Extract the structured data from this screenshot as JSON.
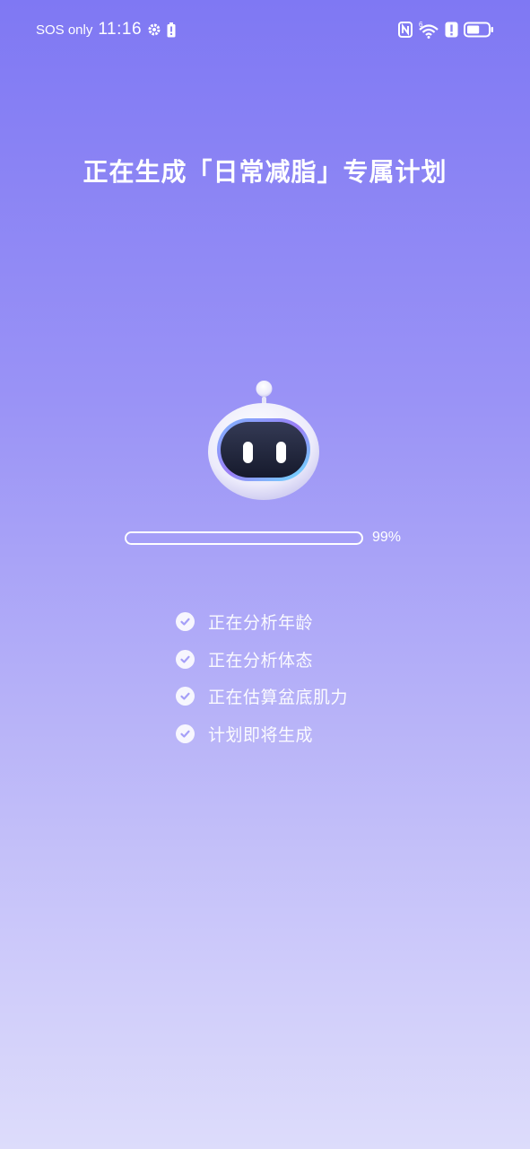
{
  "status_bar": {
    "carrier": "SOS only",
    "time": "11:16",
    "battery_level": 0.6,
    "icons": [
      "settings-icon",
      "battery-alert-icon",
      "nfc-icon",
      "wifi-icon",
      "alert-icon",
      "battery-icon"
    ]
  },
  "page": {
    "title": "正在生成「日常减脂」专属计划"
  },
  "progress": {
    "value": 99,
    "label": "99%"
  },
  "steps": [
    {
      "label": "正在分析年龄"
    },
    {
      "label": "正在分析体态"
    },
    {
      "label": "正在估算盆底肌力"
    },
    {
      "label": "计划即将生成"
    }
  ],
  "colors": {
    "gradient_top": "#7f78f3",
    "gradient_bottom": "#dddcfb",
    "progress_fill": "#a49ef8",
    "text": "#ffffff"
  }
}
